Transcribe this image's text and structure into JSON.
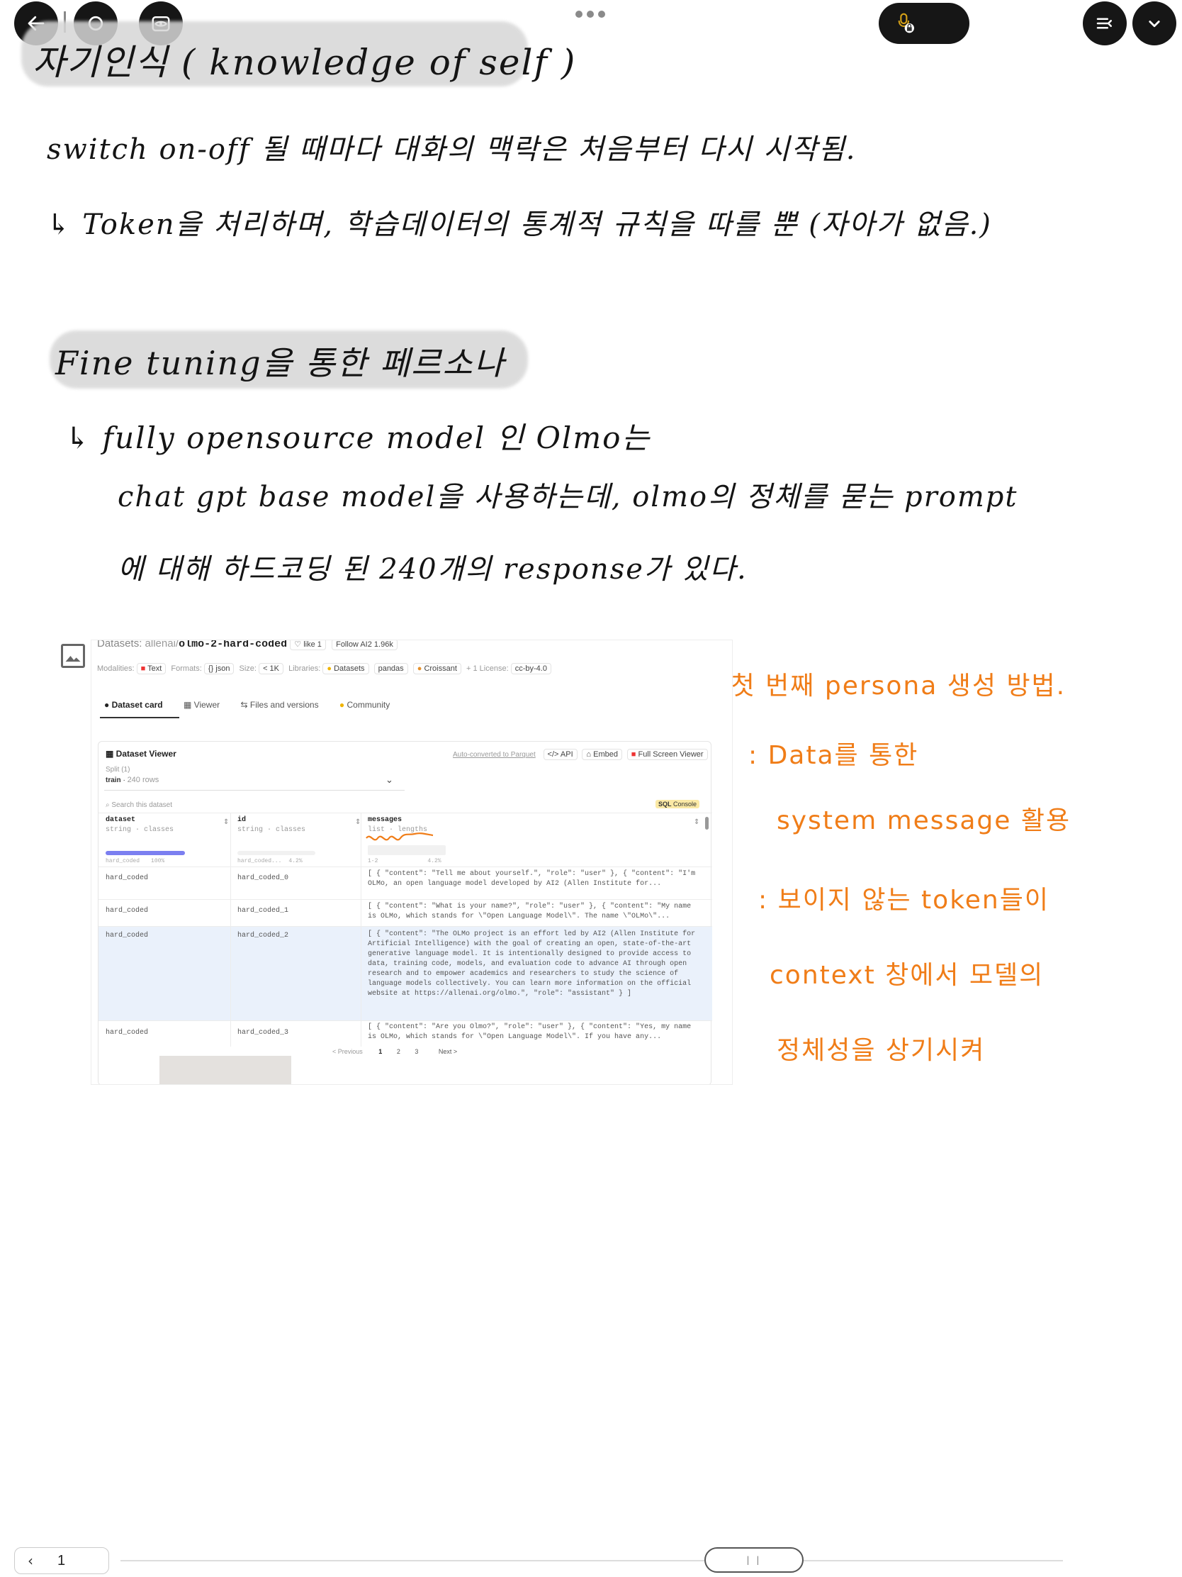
{
  "toolbar": {
    "back_icon": "arrow-left-icon",
    "record_icon": "circle-icon",
    "view_icon": "eye-frame-icon",
    "mic_icon": "mic-lock-icon",
    "list_icon": "list-icon",
    "collapse_icon": "chevron-down-icon"
  },
  "notes": {
    "line1": "자기인식 ( knowledge of self )",
    "line2": "switch on-off 될 때마다 대화의 맥락은 처음부터 다시 시작됨.",
    "line3": "↳ Token을 처리하며, 학습데이터의 통계적 규칙을 따를 뿐 (자아가 없음.)",
    "line4": "Fine tuning을 통한 페르소나",
    "line5": "↳ fully opensource model 인 Olmo는",
    "line6": "chat gpt base model을 사용하는데, olmo의 정체를 묻는 prompt",
    "line7": "에 대해 하드코딩 된 240개의 response가 있다."
  },
  "annotations": {
    "a1": "→ 첫 번째 persona 생성 방법.",
    "a2": ": Data를 통한",
    "a3": "system message 활용",
    "a4": ": 보이지 않는 token들이",
    "a5": "context 창에서 모델의",
    "a6": "정체성을 상기시켜"
  },
  "screenshot": {
    "breadcrumb_prefix": "Datasets:",
    "org": "allenai/",
    "dataset_name": "olmo-2-hard-coded",
    "like": "like",
    "like_count": "1",
    "follow": "Follow",
    "follow_org": "AI2",
    "follow_count": "1.96k",
    "modalities_label": "Modalities:",
    "modality_text": "Text",
    "formats_label": "Formats:",
    "format_json": "json",
    "size_label": "Size:",
    "size_value": "< 1K",
    "libraries_label": "Libraries:",
    "lib_datasets": "Datasets",
    "lib_pandas": "pandas",
    "lib_croissant": "Croissant",
    "lib_more": "+ 1",
    "license_label": "License:",
    "license_value": "cc-by-4.0",
    "tabs": [
      "Dataset card",
      "Viewer",
      "Files and versions",
      "Community"
    ],
    "viewer_title": "Dataset Viewer",
    "auto_converted": "Auto-converted to Parquet",
    "api": "API",
    "embed": "Embed",
    "full_screen": "Full Screen Viewer",
    "split_label": "Split (1)",
    "split_value": "train",
    "split_rows": "240 rows",
    "search_placeholder": "Search this dataset",
    "sql_console": "Console",
    "sql_badge": "SQL",
    "col_dataset": "dataset",
    "col_dataset_type": "string · classes",
    "col_id": "id",
    "col_id_type": "string · classes",
    "col_messages": "messages",
    "col_messages_type": "list · lengths",
    "dist_dataset_label": "hard_coded",
    "dist_dataset_pct": "100%",
    "dist_dataset_fraction": 1.0,
    "dist_id_label": "hard_coded...",
    "dist_id_pct": "4.2%",
    "dist_msg_range": "1-2",
    "dist_msg_pct": "4.2%",
    "rows": [
      {
        "dataset": "hard_coded",
        "id": "hard_coded_0",
        "messages": "[ { \"content\": \"Tell me about yourself.\", \"role\": \"user\" }, { \"content\": \"I'm OLMo, an open language model developed by AI2 (Allen Institute for..."
      },
      {
        "dataset": "hard_coded",
        "id": "hard_coded_1",
        "messages": "[ { \"content\": \"What is your name?\", \"role\": \"user\" }, { \"content\": \"My name is OLMo, which stands for \\\"Open Language Model\\\". The name \\\"OLMo\\\"..."
      },
      {
        "dataset": "hard_coded",
        "id": "hard_coded_2",
        "messages": "[ { \"content\": \"The OLMo project is an effort led by AI2 (Allen Institute for Artificial Intelligence) with the goal of creating an open, state-of-the-art generative language model. It is intentionally designed to provide access to data, training code, models, and evaluation code to advance AI through open research and to empower academics and researchers to study the science of language models collectively. You can learn more information on the official website at https://allenai.org/olmo.\", \"role\": \"assistant\" } ]"
      },
      {
        "dataset": "hard_coded",
        "id": "hard_coded_3",
        "messages": "[ { \"content\": \"Are you Olmo?\", \"role\": \"user\" }, { \"content\": \"Yes, my name is OLMo, which stands for \\\"Open Language Model\\\". If you have any..."
      }
    ],
    "pager_prev": "< Previous",
    "pager_pages": [
      "1",
      "2",
      "3"
    ],
    "pager_next": "Next >"
  },
  "bottom": {
    "page_number": "1",
    "prev_icon": "chevron-left-icon"
  },
  "colors": {
    "ink": "#141414",
    "orange": "#f07d18",
    "highlight": "#d7d7d7",
    "toolbar": "#161616",
    "selected_row": "#eaf1fb",
    "dist_bar": "#7b7ff0"
  }
}
